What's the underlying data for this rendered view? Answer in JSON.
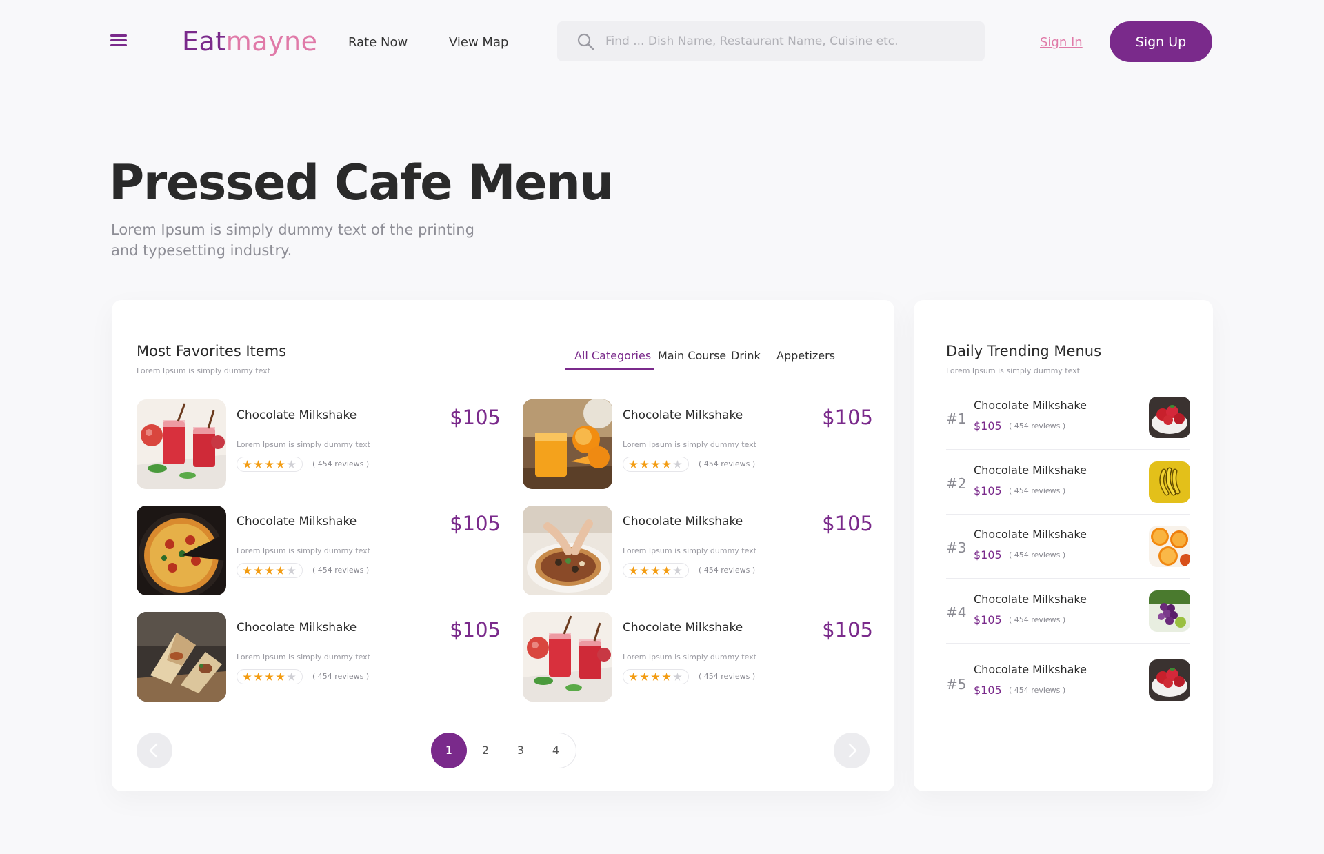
{
  "header": {
    "logo_part1": "Eat",
    "logo_part2": "mayne",
    "nav": {
      "rate_now": "Rate Now",
      "view_map": "View Map"
    },
    "search": {
      "placeholder": "Find ... Dish Name, Restaurant Name, Cuisine etc.",
      "value": ""
    },
    "sign_in": "Sign In",
    "sign_up": "Sign Up"
  },
  "hero": {
    "title": "Pressed Cafe Menu",
    "subtitle": "Lorem Ipsum is simply dummy text of the printing and typesetting industry."
  },
  "favorites": {
    "title": "Most Favorites Items",
    "subtitle": "Lorem Ipsum is simply dummy text",
    "tabs": [
      {
        "label": "All Categories",
        "active": true
      },
      {
        "label": "Main Course",
        "active": false
      },
      {
        "label": "Drink",
        "active": false
      },
      {
        "label": "Appetizers",
        "active": false
      }
    ],
    "items": [
      {
        "name": "Chocolate Milkshake",
        "desc": "Lorem Ipsum is simply dummy text",
        "price": "$105",
        "rating": 4,
        "reviews": "( 454 reviews )",
        "image": "red-smoothie-glasses"
      },
      {
        "name": "Chocolate Milkshake",
        "desc": "Lorem Ipsum is simply dummy text",
        "price": "$105",
        "rating": 4,
        "reviews": "( 454 reviews )",
        "image": "orange-juice-glass"
      },
      {
        "name": "Chocolate Milkshake",
        "desc": "Lorem Ipsum is simply dummy text",
        "price": "$105",
        "rating": 4,
        "reviews": "( 454 reviews )",
        "image": "pizza-pan"
      },
      {
        "name": "Chocolate Milkshake",
        "desc": "Lorem Ipsum is simply dummy text",
        "price": "$105",
        "rating": 4,
        "reviews": "( 454 reviews )",
        "image": "pizza-plate"
      },
      {
        "name": "Chocolate Milkshake",
        "desc": "Lorem Ipsum is simply dummy text",
        "price": "$105",
        "rating": 4,
        "reviews": "( 454 reviews )",
        "image": "wrap-burrito"
      },
      {
        "name": "Chocolate Milkshake",
        "desc": "Lorem Ipsum is simply dummy text",
        "price": "$105",
        "rating": 4,
        "reviews": "( 454 reviews )",
        "image": "red-smoothie-glasses"
      }
    ],
    "pagination": {
      "pages": [
        "1",
        "2",
        "3",
        "4"
      ],
      "current": "1"
    }
  },
  "trending": {
    "title": "Daily Trending Menus",
    "subtitle": "Lorem Ipsum is simply dummy text",
    "items": [
      {
        "rank": "#1",
        "name": "Chocolate Milkshake",
        "price": "$105",
        "reviews": "( 454 reviews )",
        "image": "strawberries-bowl"
      },
      {
        "rank": "#2",
        "name": "Chocolate Milkshake",
        "price": "$105",
        "reviews": "( 454 reviews )",
        "image": "bananas"
      },
      {
        "rank": "#3",
        "name": "Chocolate Milkshake",
        "price": "$105",
        "reviews": "( 454 reviews )",
        "image": "orange-slices"
      },
      {
        "rank": "#4",
        "name": "Chocolate Milkshake",
        "price": "$105",
        "reviews": "( 454 reviews )",
        "image": "grapes"
      },
      {
        "rank": "#5",
        "name": "Chocolate Milkshake",
        "price": "$105",
        "reviews": "( 454 reviews )",
        "image": "strawberries-bowl"
      }
    ]
  },
  "colors": {
    "brand": "#7a2a8b",
    "accent_pink": "#e07aa8",
    "star": "#f39c12",
    "star_empty": "#cfcfd4",
    "background": "#f8f8fa"
  }
}
